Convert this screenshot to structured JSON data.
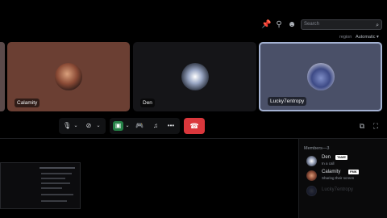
{
  "toolbar": {
    "icons": [
      "pin-icon",
      "bike-icon",
      "user-icon"
    ],
    "search_placeholder": "Search",
    "region_label": "region",
    "region_value": "Automatic ▾"
  },
  "tiles": [
    {
      "name": "Calamity"
    },
    {
      "name": "Den"
    },
    {
      "name": "Lucky7entropy"
    }
  ],
  "controls": {
    "mic": "microphone-icon",
    "camera": "camera-off-icon",
    "screenshare": "screenshare-icon",
    "activity": "gamepad-icon",
    "soundboard": "soundboard-icon",
    "more": "more-icon",
    "hangup": "hangup-icon"
  },
  "members": {
    "header": "Members—3",
    "list": [
      {
        "name": "Den",
        "tag": "TAME",
        "status": "In a call"
      },
      {
        "name": "Calamity",
        "tag": "FMK",
        "status": "Sharing their screen"
      },
      {
        "name": "Lucky7entropy",
        "tag": "",
        "status": ""
      }
    ]
  },
  "colors": {
    "hangup": "#da373c",
    "share_active": "#248046",
    "speaking_border": "#a3b1d1"
  }
}
